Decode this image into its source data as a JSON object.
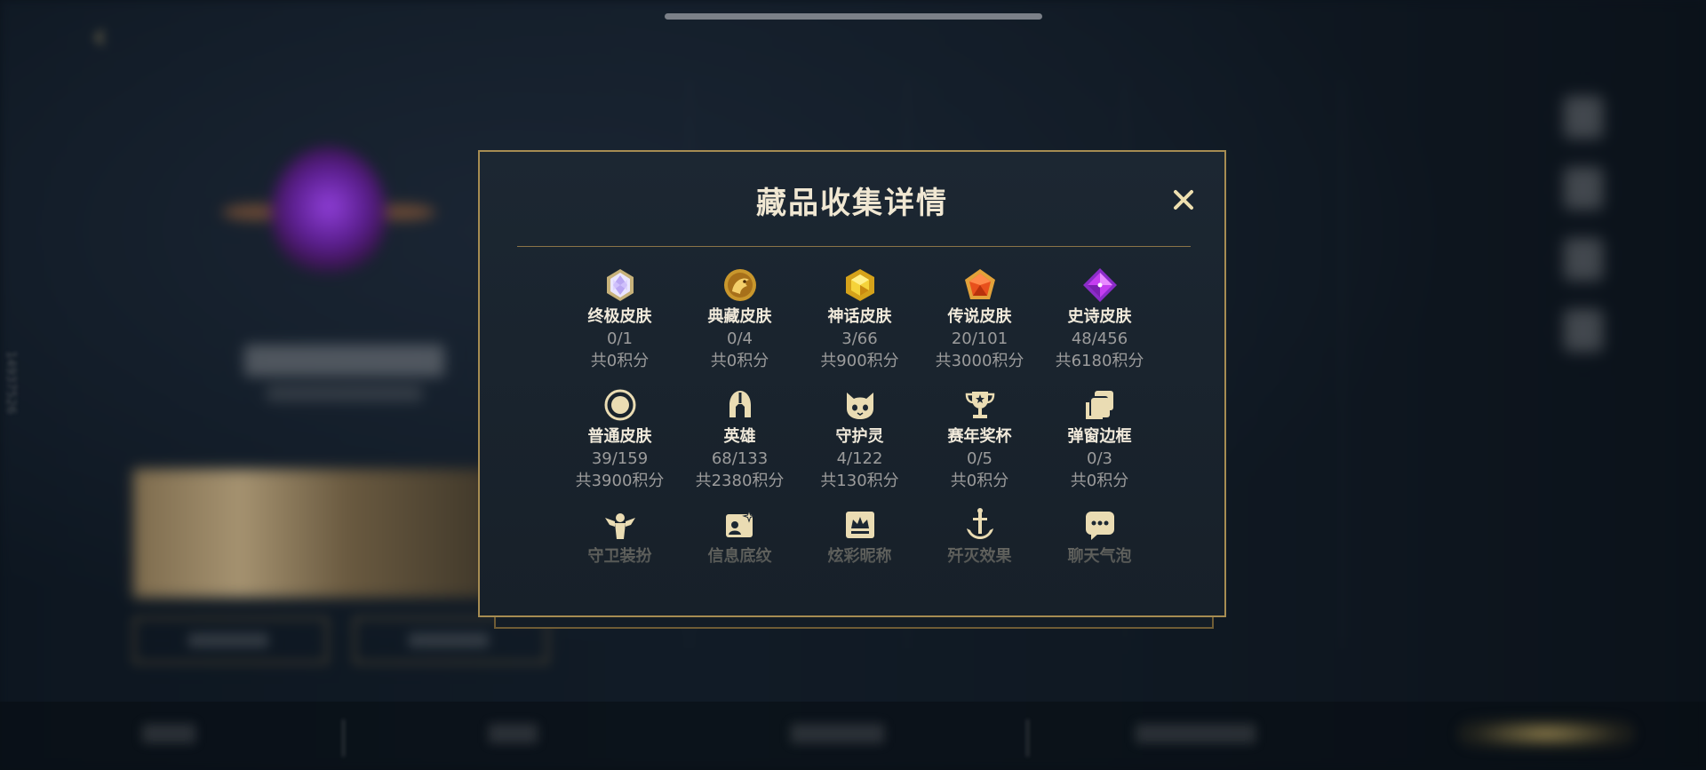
{
  "background": {
    "side_vertical_text": "14937526"
  },
  "modal": {
    "title": "藏品收集详情",
    "close_icon": "close-icon",
    "items": [
      {
        "label": "终极皮肤",
        "count": "0/1",
        "points": "共0积分",
        "icon": "ultimate-skin-icon"
      },
      {
        "label": "典藏皮肤",
        "count": "0/4",
        "points": "共0积分",
        "icon": "collector-skin-icon"
      },
      {
        "label": "神话皮肤",
        "count": "3/66",
        "points": "共900积分",
        "icon": "mythic-skin-icon"
      },
      {
        "label": "传说皮肤",
        "count": "20/101",
        "points": "共3000积分",
        "icon": "legendary-skin-icon"
      },
      {
        "label": "史诗皮肤",
        "count": "48/456",
        "points": "共6180积分",
        "icon": "epic-skin-icon"
      },
      {
        "label": "普通皮肤",
        "count": "39/159",
        "points": "共3900积分",
        "icon": "normal-skin-icon"
      },
      {
        "label": "英雄",
        "count": "68/133",
        "points": "共2380积分",
        "icon": "hero-helmet-icon"
      },
      {
        "label": "守护灵",
        "count": "4/122",
        "points": "共130积分",
        "icon": "guardian-spirit-icon"
      },
      {
        "label": "赛年奖杯",
        "count": "0/5",
        "points": "共0积分",
        "icon": "trophy-icon"
      },
      {
        "label": "弹窗边框",
        "count": "0/3",
        "points": "共0积分",
        "icon": "popup-frame-icon"
      },
      {
        "label": "守卫装扮",
        "icon": "guard-costume-icon"
      },
      {
        "label": "信息底纹",
        "icon": "info-background-icon"
      },
      {
        "label": "炫彩昵称",
        "icon": "colorful-nickname-icon"
      },
      {
        "label": "歼灭效果",
        "icon": "annihilation-effect-icon"
      },
      {
        "label": "聊天气泡",
        "icon": "chat-bubble-icon"
      }
    ]
  }
}
